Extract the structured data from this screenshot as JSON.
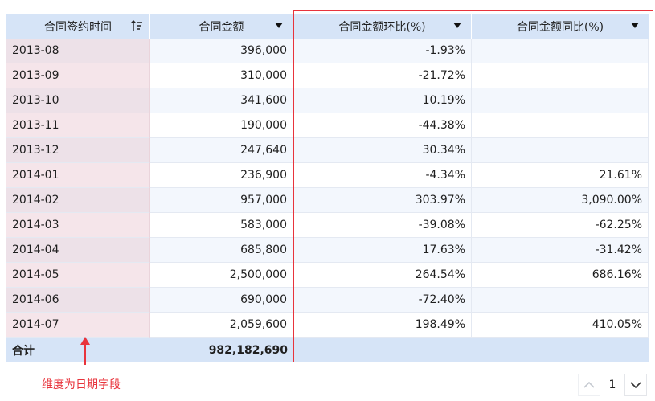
{
  "table": {
    "headers": [
      "合同签约时间",
      "合同金额",
      "合同金额环比(%)",
      "合同金额同比(%)"
    ],
    "rows": [
      [
        "2013-08",
        "396,000",
        "-1.93%",
        ""
      ],
      [
        "2013-09",
        "310,000",
        "-21.72%",
        ""
      ],
      [
        "2013-10",
        "341,600",
        "10.19%",
        ""
      ],
      [
        "2013-11",
        "190,000",
        "-44.38%",
        ""
      ],
      [
        "2013-12",
        "247,640",
        "30.34%",
        ""
      ],
      [
        "2014-01",
        "236,900",
        "-4.34%",
        "21.61%"
      ],
      [
        "2014-02",
        "957,000",
        "303.97%",
        "3,090.00%"
      ],
      [
        "2014-03",
        "583,000",
        "-39.08%",
        "-62.25%"
      ],
      [
        "2014-04",
        "685,800",
        "17.63%",
        "-31.42%"
      ],
      [
        "2014-05",
        "2,500,000",
        "264.54%",
        "686.16%"
      ],
      [
        "2014-06",
        "690,000",
        "-72.40%",
        ""
      ],
      [
        "2014-07",
        "2,059,600",
        "198.49%",
        "410.05%"
      ]
    ],
    "total": {
      "label": "合计",
      "amount": "982,182,690",
      "mom": "",
      "yoy": ""
    }
  },
  "annotation": {
    "text": "维度为日期字段",
    "color": "#e8343c"
  },
  "pagination": {
    "current_page": "1"
  },
  "colors": {
    "header_bg": "#d6e4f7",
    "date_col_bg": "#f5e5ea",
    "highlight_border": "#e8343c"
  },
  "icons": [
    "sort-icon",
    "dropdown-icon",
    "chevron-up-icon",
    "chevron-down-icon",
    "arrow-up-icon"
  ]
}
